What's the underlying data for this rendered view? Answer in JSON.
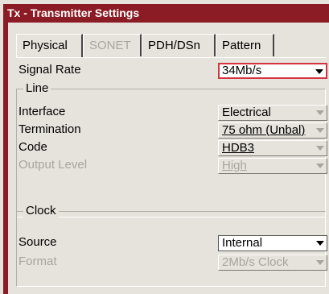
{
  "window": {
    "title": "Tx - Transmitter Settings"
  },
  "tabs": [
    {
      "label": "Physical",
      "state": "active"
    },
    {
      "label": "SONET",
      "state": "disabled"
    },
    {
      "label": "PDH/DSn",
      "state": "enabled"
    },
    {
      "label": "Pattern",
      "state": "enabled"
    }
  ],
  "signal_rate": {
    "label": "Signal Rate",
    "value": "34Mb/s"
  },
  "line_group": {
    "title": "Line",
    "interface": {
      "label": "Interface",
      "value": "Electrical"
    },
    "termination": {
      "label": "Termination",
      "value": "75 ohm (Unbal)"
    },
    "code": {
      "label": "Code",
      "value": "HDB3"
    },
    "output_level": {
      "label": "Output Level",
      "value": "High"
    }
  },
  "clock_group": {
    "title": "Clock",
    "source": {
      "label": "Source",
      "value": "Internal"
    },
    "format": {
      "label": "Format",
      "value": "2Mb/s Clock"
    }
  },
  "colors": {
    "title_bar": "#8b1c25",
    "focus_border": "#d4333f",
    "disabled_text": "#a8a4a0",
    "panel_bg": "#e6e2dc"
  },
  "icons": {
    "dropdown": "chevron-down-icon"
  }
}
